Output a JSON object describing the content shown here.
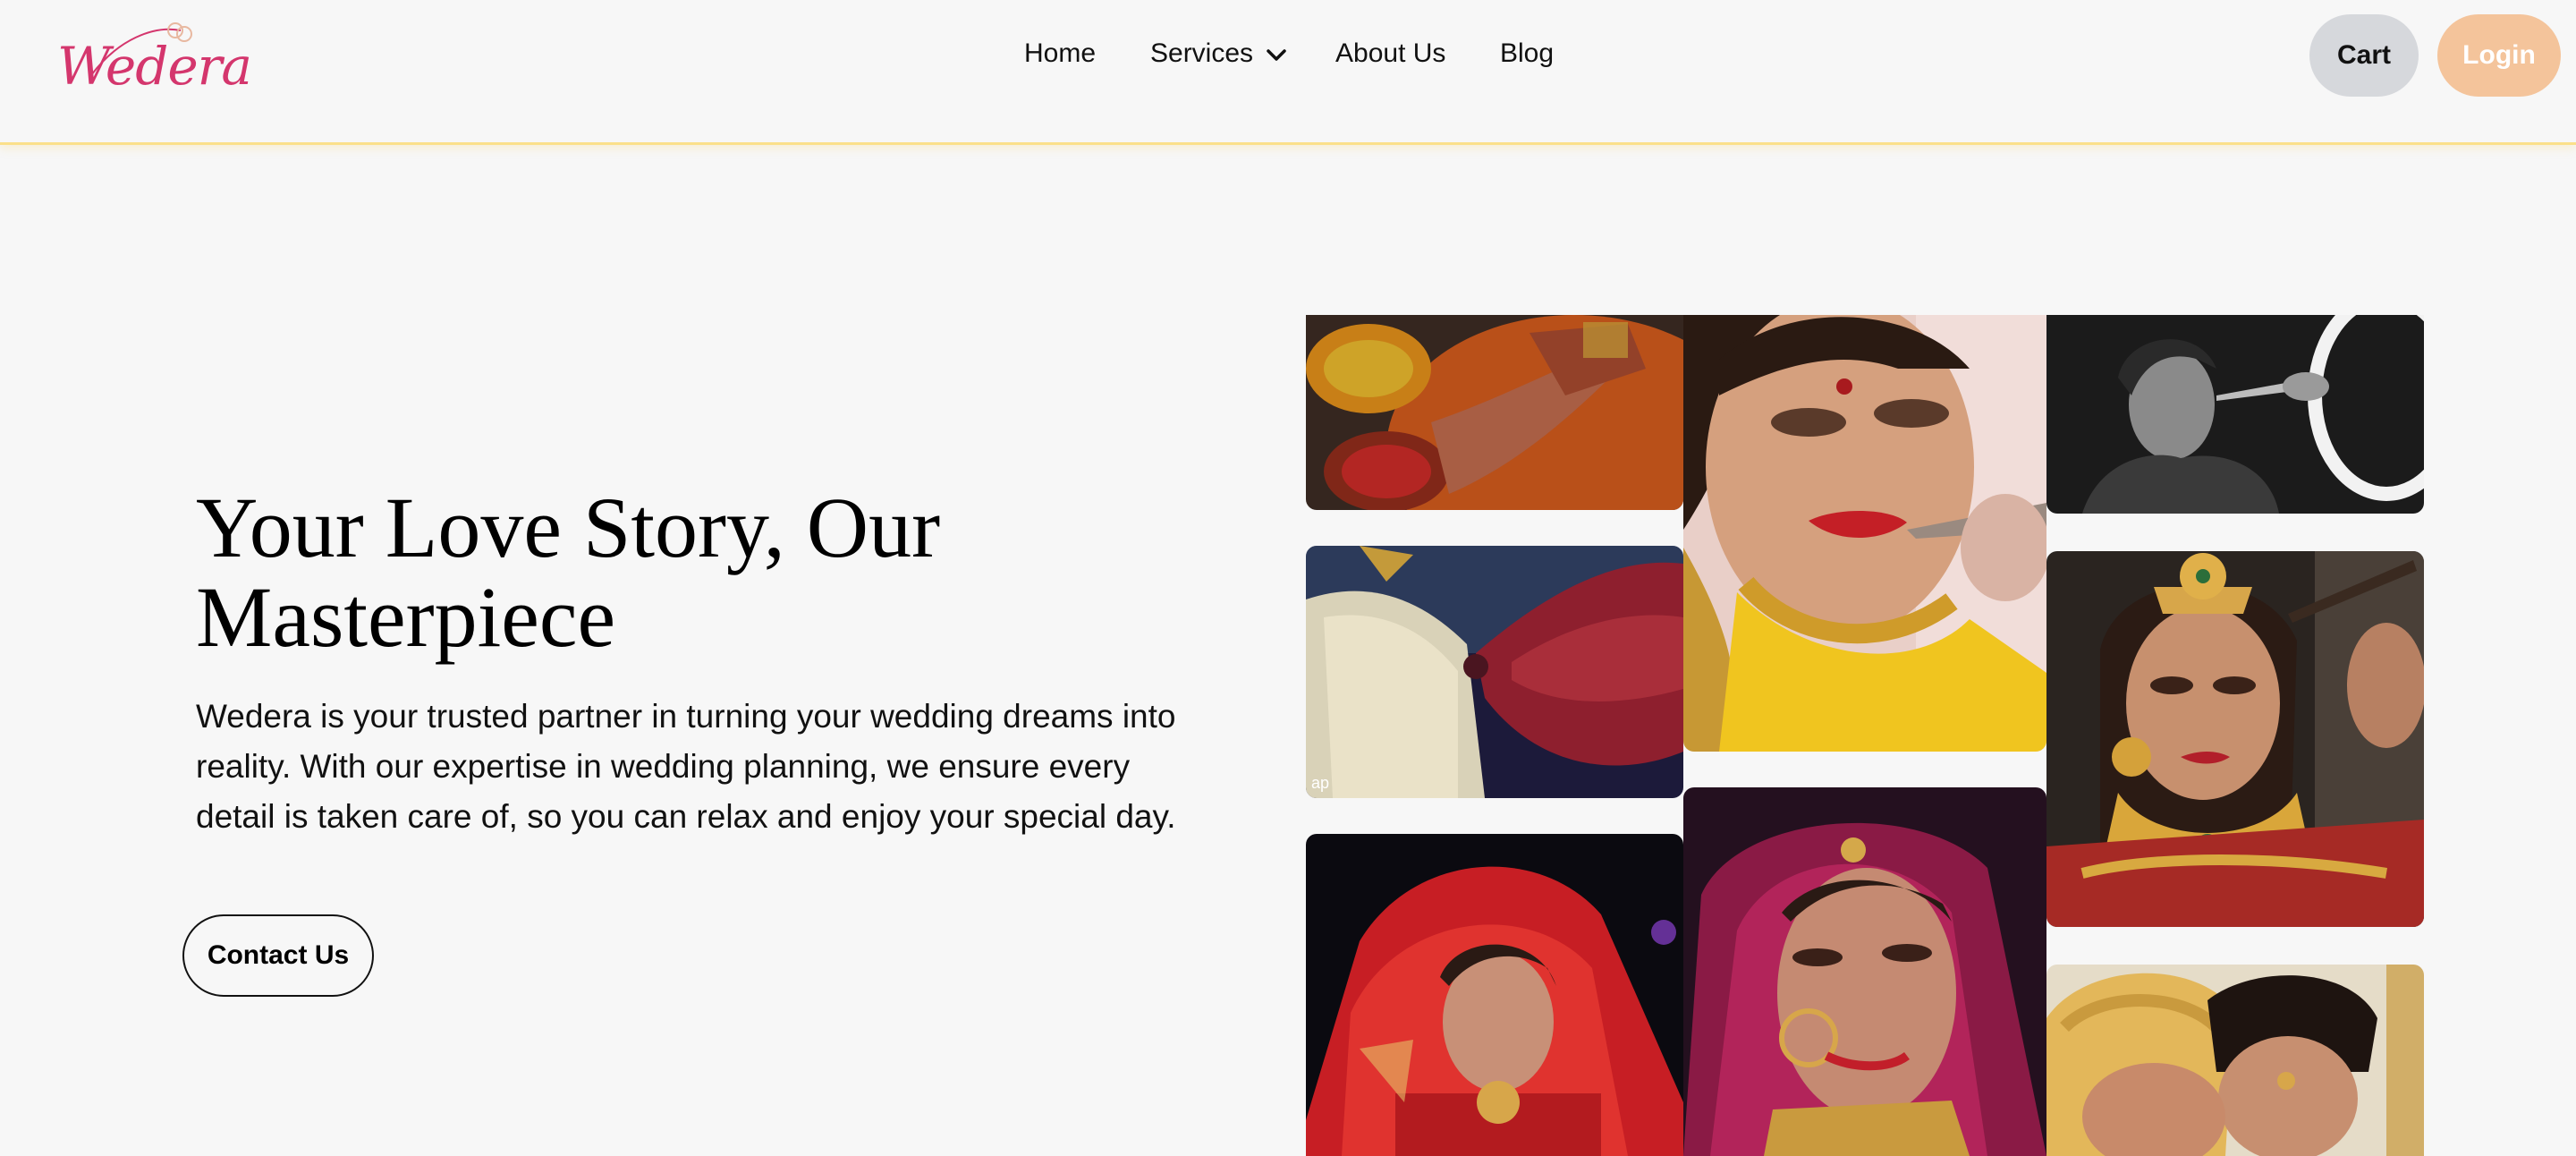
{
  "brand": {
    "logo_text": "Wedera"
  },
  "nav": {
    "home": "Home",
    "services": "Services",
    "about": "About Us",
    "blog": "Blog"
  },
  "actions": {
    "cart": "Cart",
    "login": "Login"
  },
  "hero": {
    "title": "Your Love Story, Our Masterpiece",
    "body": "Wedera is your trusted partner in turning your wedding dreams into reality. With our expertise in wedding planning, we ensure every detail is taken care of, so you can relax and enjoy your special day.",
    "cta": "Contact Us"
  },
  "gallery": {
    "tiles": [
      {
        "subject": "mehndi-hands-with-bowls",
        "watermark": ""
      },
      {
        "subject": "saree-fabric-drape",
        "watermark": "ap"
      },
      {
        "subject": "bride-red-veil"
      },
      {
        "subject": "bride-lipstick-application"
      },
      {
        "subject": "bride-pink-dupatta-nose-ring"
      },
      {
        "subject": "black-and-white-makeup-ring-light"
      },
      {
        "subject": "bride-eye-makeup-gold-jewelry"
      },
      {
        "subject": "couple-groom-turban"
      }
    ]
  },
  "colors": {
    "background": "#f7f7f7",
    "brand": "#d4366d",
    "header_border": "#fbe08a",
    "cart_bg": "#d6d8dc",
    "login_bg": "#f4c49b"
  }
}
